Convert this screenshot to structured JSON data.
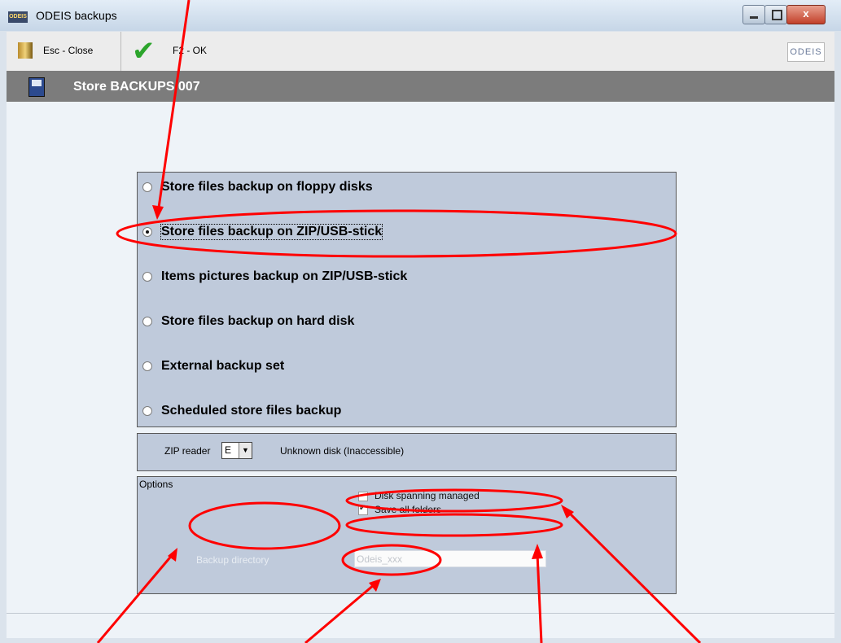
{
  "window": {
    "title": "ODEIS backups",
    "app_icon_text": "ODEIS",
    "close_glyph": "x"
  },
  "toolbar": {
    "close_label": "Esc - Close",
    "ok_label": "F2 - OK",
    "logo": "ODEIS"
  },
  "header": {
    "title": "Store BACKUPS 007"
  },
  "backup_options": [
    {
      "label": "Store files backup on floppy disks",
      "selected": false
    },
    {
      "label": "Store files backup on ZIP/USB-stick",
      "selected": true
    },
    {
      "label": "Items pictures backup on ZIP/USB-stick",
      "selected": false
    },
    {
      "label": "Store files backup on hard disk",
      "selected": false
    },
    {
      "label": "External backup set",
      "selected": false
    },
    {
      "label": "Scheduled store files backup",
      "selected": false
    }
  ],
  "zip": {
    "label": "ZIP reader",
    "value": "E",
    "info": "Unknown disk  (Inaccessible)"
  },
  "options": {
    "title": "Options",
    "disk_spanning": {
      "label": "Disk spanning managed",
      "checked": false
    },
    "save_all_folders": {
      "label": "Save all folders",
      "checked": true
    },
    "backup_dir_label": "Backup directory",
    "backup_dir_value": "Odeis_xxx"
  },
  "annotation_color": "#ff0000"
}
